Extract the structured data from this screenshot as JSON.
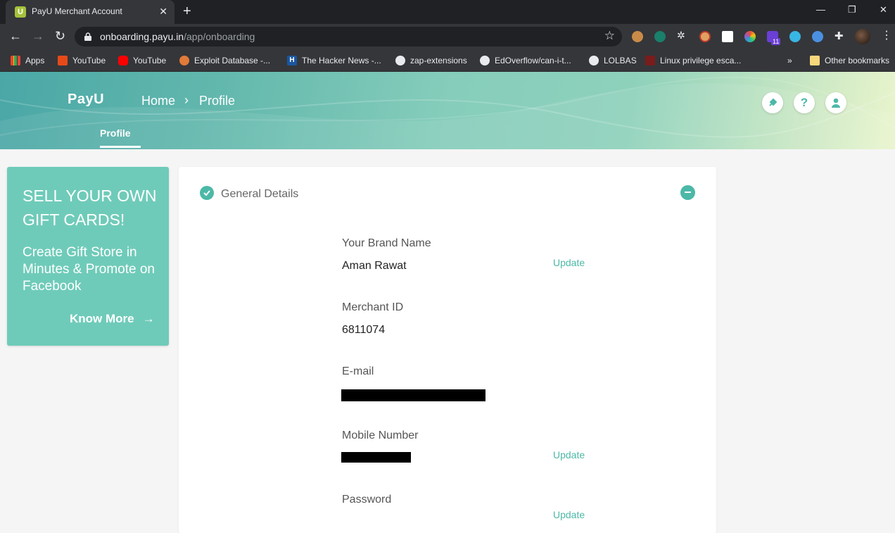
{
  "browser": {
    "tab_title": "PayU Merchant Account",
    "tab_favicon_letter": "U",
    "url_domain": "onboarding.payu.in",
    "url_path": "/app/onboarding",
    "bookmarks": [
      {
        "label": "Apps",
        "icon": "apps-grid-icon"
      },
      {
        "label": "YouTube",
        "icon": "youtube-analytics-icon"
      },
      {
        "label": "YouTube",
        "icon": "youtube-icon"
      },
      {
        "label": "Exploit Database -...",
        "icon": "exploit-db-icon"
      },
      {
        "label": "The Hacker News -...",
        "icon": "hacker-news-icon"
      },
      {
        "label": "zap-extensions",
        "icon": "github-icon"
      },
      {
        "label": "EdOverflow/can-i-t...",
        "icon": "github-icon"
      },
      {
        "label": "LOLBAS",
        "icon": "globe-icon"
      },
      {
        "label": "Linux privilege esca...",
        "icon": "bookmark-icon"
      },
      {
        "label": "Other bookmarks",
        "icon": "folder-icon"
      }
    ],
    "more_bookmarks": "»",
    "extension_badge": "11"
  },
  "header": {
    "logo": "PayU",
    "breadcrumb": [
      "Home",
      "Profile"
    ],
    "active_tab": "Profile",
    "icons": [
      "integration-icon",
      "help-icon",
      "account-icon"
    ],
    "help_glyph": "?"
  },
  "promo": {
    "title": "SELL YOUR OWN GIFT CARDS!",
    "description": "Create Gift Store in Minutes & Promote on Facebook",
    "cta": "Know More"
  },
  "general_details": {
    "title": "General Details",
    "fields": [
      {
        "label": "Your Brand Name",
        "value": "Aman Rawat",
        "action": "Update"
      },
      {
        "label": "Merchant ID",
        "value": "6811074"
      },
      {
        "label": "E-mail",
        "value": "[redacted]"
      },
      {
        "label": "Mobile Number",
        "value": "[redacted]",
        "action": "Update"
      },
      {
        "label": "Password",
        "action": "Update"
      }
    ]
  },
  "colors": {
    "accent": "#4cb8a7",
    "promo_bg": "#6fcbb9",
    "chrome_dark": "#202124",
    "chrome_toolbar": "#35363a"
  }
}
